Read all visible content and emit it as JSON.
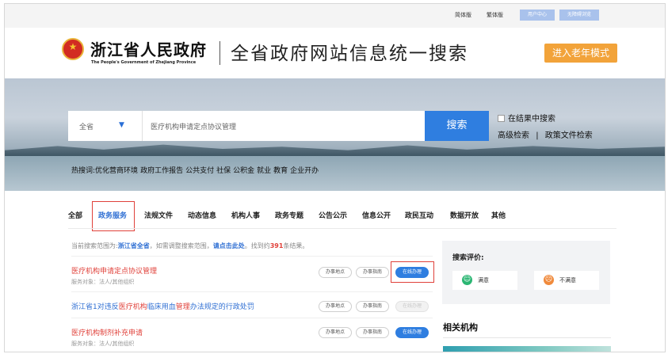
{
  "topbar": {
    "simplified": "简体版",
    "traditional": "繁体版",
    "user_center": "用户中心",
    "accessible": "无障碍浏览"
  },
  "header": {
    "site_name": "浙江省人民政府",
    "site_name_en": "The People's Government of Zhejiang Province",
    "title": "全省政府网站信息统一搜索",
    "elder_mode": "进入老年模式"
  },
  "search": {
    "scope": "全省",
    "query": "医疗机构申请定点协议管理",
    "button": "搜索",
    "in_result": "在结果中搜索",
    "advanced": "高级检索",
    "separator": "|",
    "policy": "政策文件检索"
  },
  "hot": {
    "label": "热搜词:",
    "terms": [
      "优化营商环境",
      "政府工作报告",
      "公共支付",
      "社保",
      "公积金",
      "就业",
      "教育",
      "企业开办"
    ]
  },
  "tabs": [
    "全部",
    "政务服务",
    "法规文件",
    "动态信息",
    "机构人事",
    "政务专题",
    "公告公示",
    "信息公开",
    "政民互动",
    "数据开放",
    "其他"
  ],
  "scope_info": {
    "prefix": "当前搜索范围为:",
    "scope": "浙江省全省",
    "mid": "，如需调整搜索范围，",
    "link": "请点击此处",
    "found_prefix": "。找到约",
    "count": "391",
    "found_suffix": "条结果。"
  },
  "results": [
    {
      "title_hl1": "医疗机构申请定点协议管理",
      "title_mid": "",
      "title_hl2": "",
      "title_end": "",
      "sub": "服务对象：法人/其他组织",
      "btn_place": "办事地点",
      "btn_guide": "办事指南",
      "btn_online": "在线办理"
    },
    {
      "title_pre": "浙江省1对违反",
      "title_hl1": "医疗机构",
      "title_mid": "临床用血",
      "title_hl2": "管理",
      "title_end": "办法规定的行政处罚",
      "btn_place": "办事地点",
      "btn_guide": "办事指南",
      "btn_online": "在线办理"
    },
    {
      "title_hl1": "医疗机构",
      "title_mid": "制剂补充申请",
      "sub": "服务对象：法人/其他组织",
      "btn_place": "办事地点",
      "btn_guide": "办事指南",
      "btn_online": "在线办理"
    }
  ],
  "evaluation": {
    "title": "搜索评价:",
    "satisfied": "满意",
    "unsatisfied": "不满意"
  },
  "related": {
    "title": "相关机构"
  },
  "colors": {
    "accent_blue": "#2f7ee0",
    "highlight_red": "#e0413a",
    "elder_orange": "#f2a33a"
  }
}
